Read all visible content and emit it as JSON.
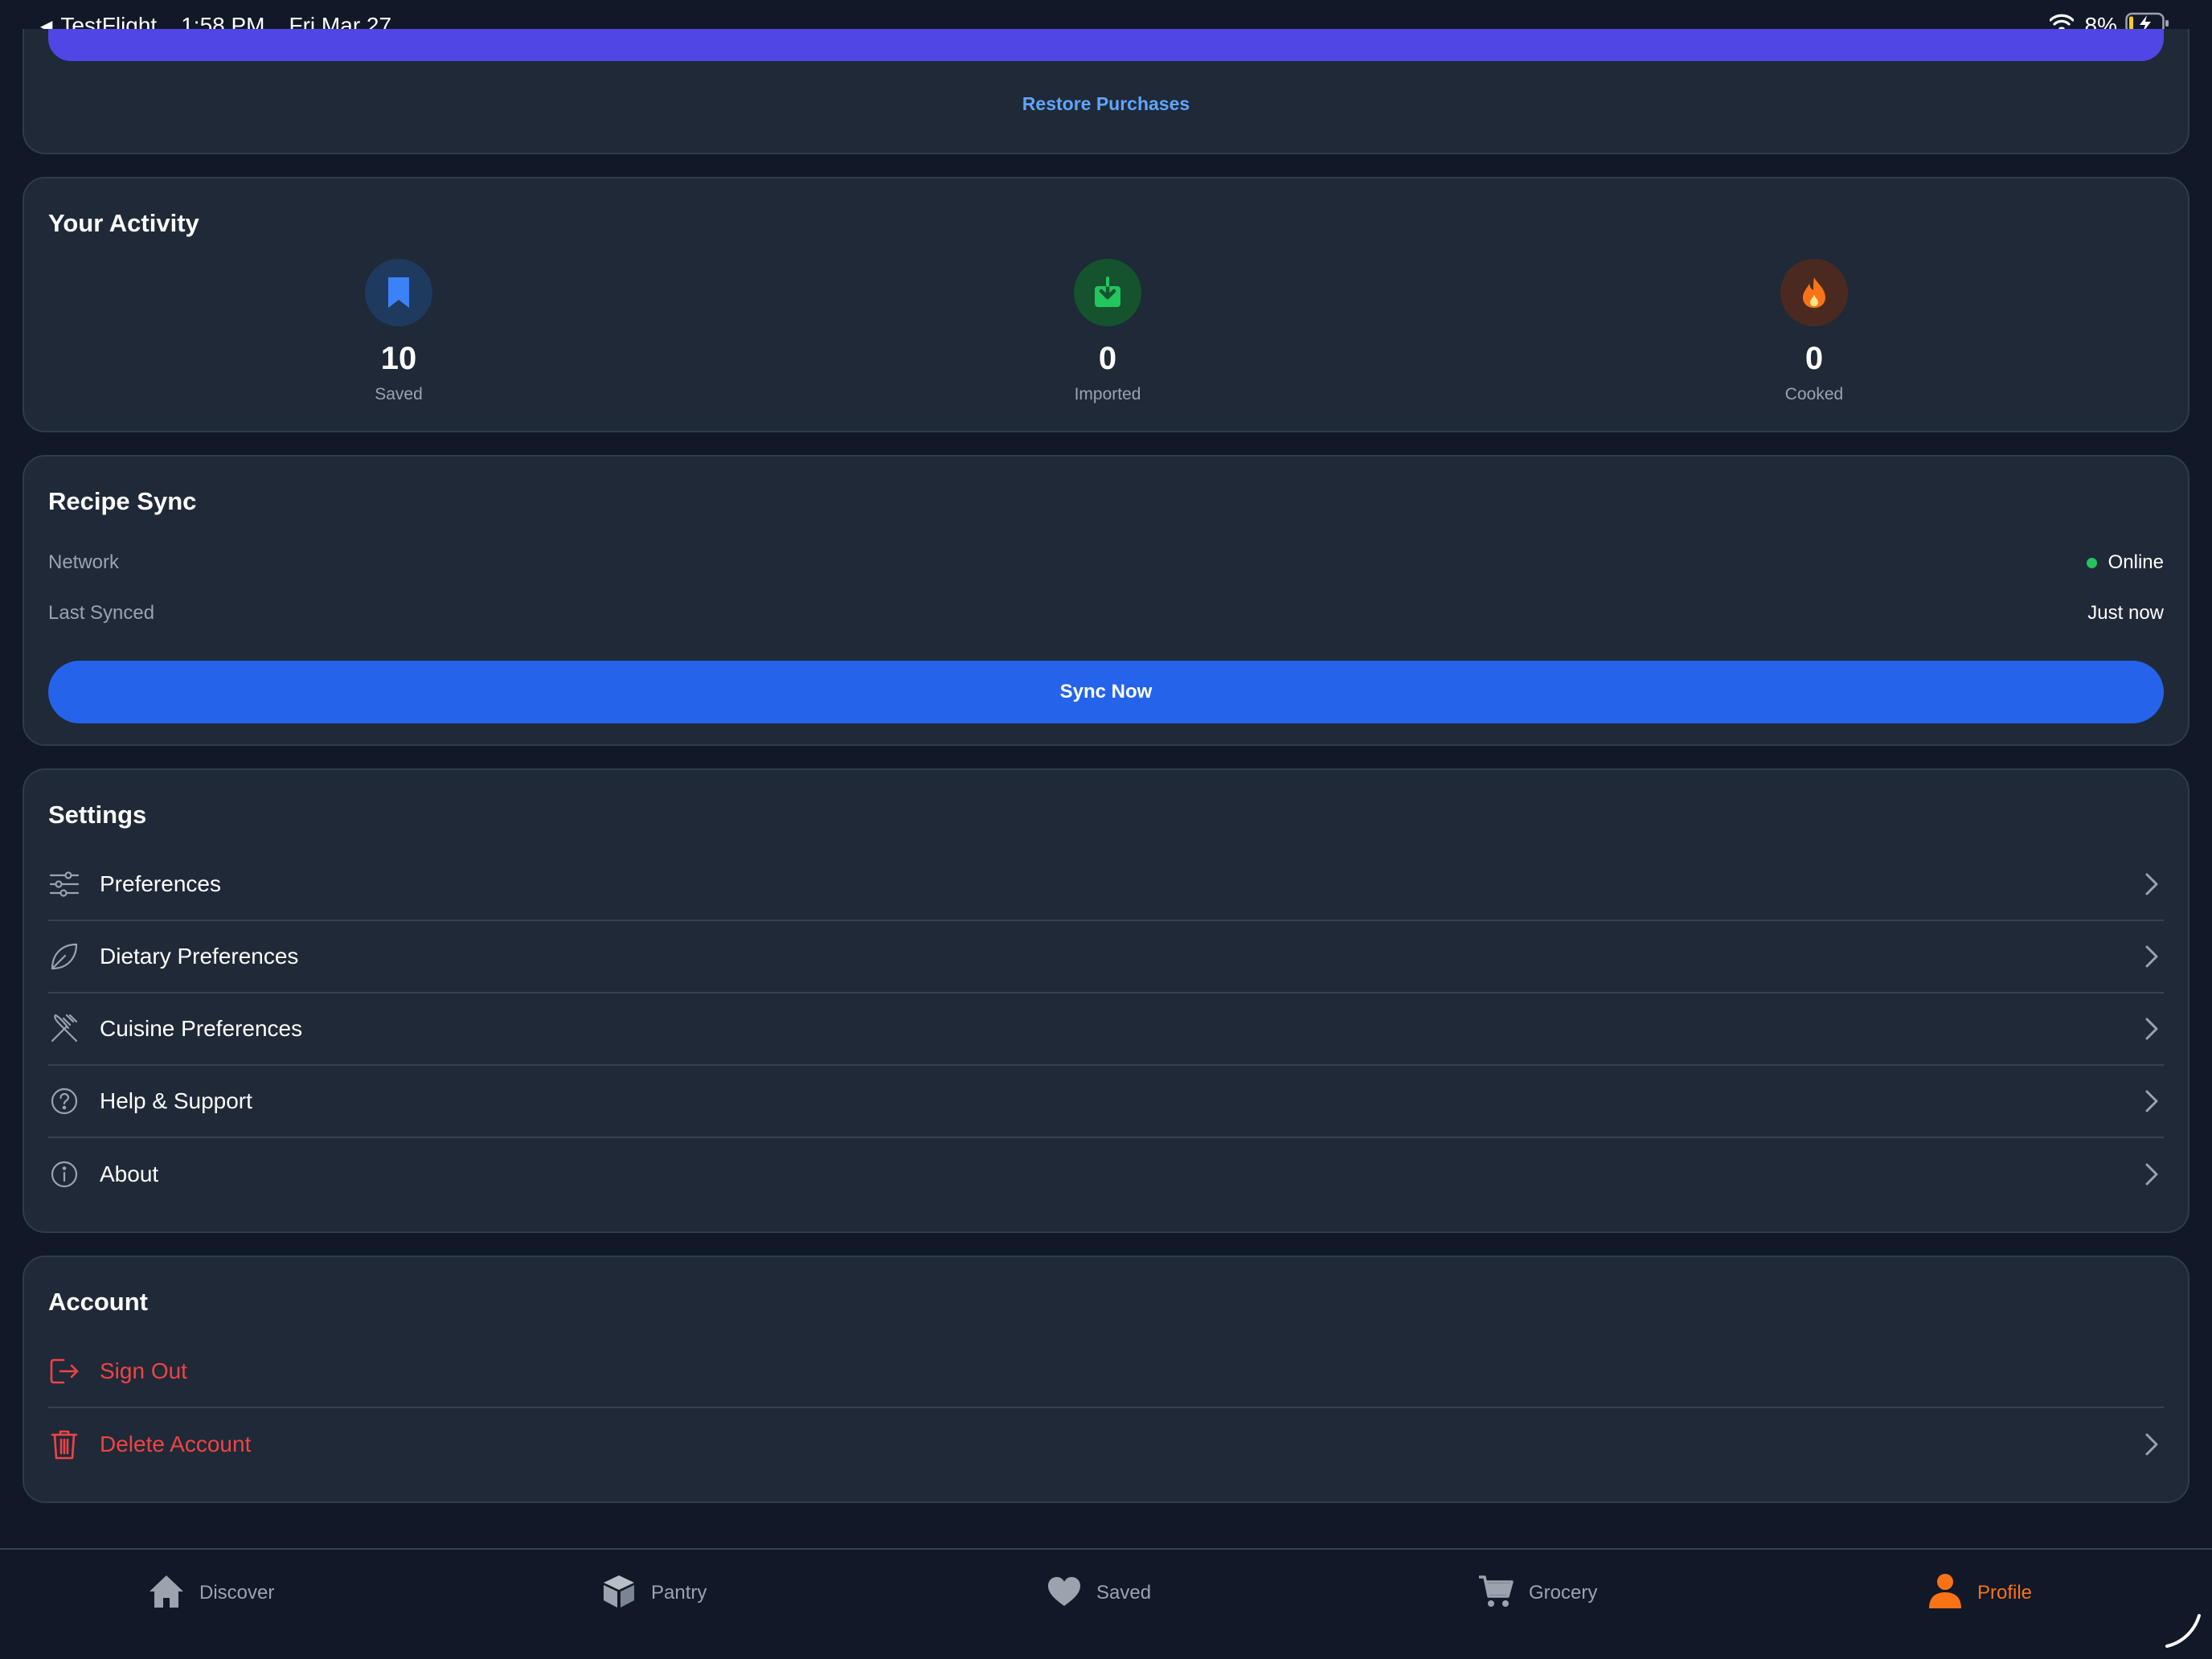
{
  "status_bar": {
    "back_app": "TestFlight",
    "time": "1:58 PM",
    "date": "Fri Mar 27",
    "battery_percent": "8%"
  },
  "top_card": {
    "restore_label": "Restore Purchases"
  },
  "activity": {
    "title": "Your Activity",
    "stats": [
      {
        "value": "10",
        "label": "Saved",
        "icon": "bookmark-icon",
        "color": "#3b82f6"
      },
      {
        "value": "0",
        "label": "Imported",
        "icon": "import-icon",
        "color": "#22c55e"
      },
      {
        "value": "0",
        "label": "Cooked",
        "icon": "flame-icon",
        "color": "#f97316"
      }
    ]
  },
  "sync": {
    "title": "Recipe Sync",
    "network_label": "Network",
    "network_value": "Online",
    "last_synced_label": "Last Synced",
    "last_synced_value": "Just now",
    "button_label": "Sync Now"
  },
  "settings": {
    "title": "Settings",
    "items": [
      {
        "label": "Preferences",
        "icon": "sliders-icon"
      },
      {
        "label": "Dietary Preferences",
        "icon": "leaf-icon"
      },
      {
        "label": "Cuisine Preferences",
        "icon": "utensils-icon"
      },
      {
        "label": "Help & Support",
        "icon": "help-circle-icon"
      },
      {
        "label": "About",
        "icon": "info-circle-icon"
      }
    ]
  },
  "account": {
    "title": "Account",
    "sign_out_label": "Sign Out",
    "delete_label": "Delete Account"
  },
  "tabs": [
    {
      "label": "Discover",
      "icon": "home-icon"
    },
    {
      "label": "Pantry",
      "icon": "box-icon"
    },
    {
      "label": "Saved",
      "icon": "heart-icon"
    },
    {
      "label": "Grocery",
      "icon": "cart-icon"
    },
    {
      "label": "Profile",
      "icon": "person-icon",
      "active": true
    }
  ],
  "colors": {
    "background": "#111827",
    "card": "#1f2937",
    "accent_blue": "#2563eb",
    "link_blue": "#60a5fa",
    "danger": "#ef4444",
    "active_tab": "#f97316",
    "online": "#22c55e"
  }
}
